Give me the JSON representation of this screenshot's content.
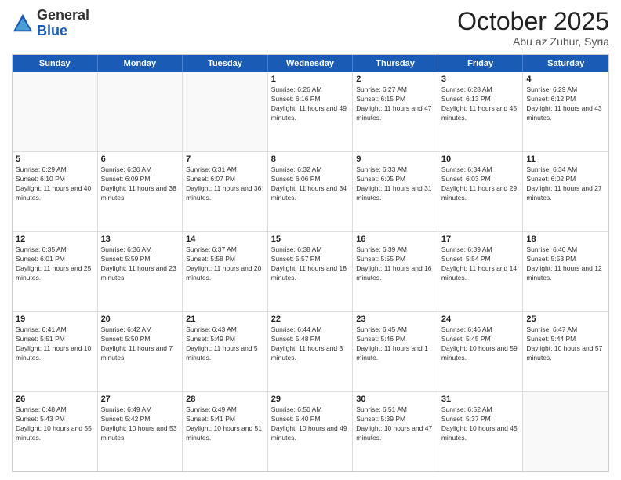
{
  "logo": {
    "general": "General",
    "blue": "Blue"
  },
  "title": {
    "month_year": "October 2025",
    "location": "Abu az Zuhur, Syria"
  },
  "header_days": [
    "Sunday",
    "Monday",
    "Tuesday",
    "Wednesday",
    "Thursday",
    "Friday",
    "Saturday"
  ],
  "weeks": [
    [
      {
        "day": "",
        "sunrise": "",
        "sunset": "",
        "daylight": ""
      },
      {
        "day": "",
        "sunrise": "",
        "sunset": "",
        "daylight": ""
      },
      {
        "day": "",
        "sunrise": "",
        "sunset": "",
        "daylight": ""
      },
      {
        "day": "1",
        "sunrise": "Sunrise: 6:26 AM",
        "sunset": "Sunset: 6:16 PM",
        "daylight": "Daylight: 11 hours and 49 minutes."
      },
      {
        "day": "2",
        "sunrise": "Sunrise: 6:27 AM",
        "sunset": "Sunset: 6:15 PM",
        "daylight": "Daylight: 11 hours and 47 minutes."
      },
      {
        "day": "3",
        "sunrise": "Sunrise: 6:28 AM",
        "sunset": "Sunset: 6:13 PM",
        "daylight": "Daylight: 11 hours and 45 minutes."
      },
      {
        "day": "4",
        "sunrise": "Sunrise: 6:29 AM",
        "sunset": "Sunset: 6:12 PM",
        "daylight": "Daylight: 11 hours and 43 minutes."
      }
    ],
    [
      {
        "day": "5",
        "sunrise": "Sunrise: 6:29 AM",
        "sunset": "Sunset: 6:10 PM",
        "daylight": "Daylight: 11 hours and 40 minutes."
      },
      {
        "day": "6",
        "sunrise": "Sunrise: 6:30 AM",
        "sunset": "Sunset: 6:09 PM",
        "daylight": "Daylight: 11 hours and 38 minutes."
      },
      {
        "day": "7",
        "sunrise": "Sunrise: 6:31 AM",
        "sunset": "Sunset: 6:07 PM",
        "daylight": "Daylight: 11 hours and 36 minutes."
      },
      {
        "day": "8",
        "sunrise": "Sunrise: 6:32 AM",
        "sunset": "Sunset: 6:06 PM",
        "daylight": "Daylight: 11 hours and 34 minutes."
      },
      {
        "day": "9",
        "sunrise": "Sunrise: 6:33 AM",
        "sunset": "Sunset: 6:05 PM",
        "daylight": "Daylight: 11 hours and 31 minutes."
      },
      {
        "day": "10",
        "sunrise": "Sunrise: 6:34 AM",
        "sunset": "Sunset: 6:03 PM",
        "daylight": "Daylight: 11 hours and 29 minutes."
      },
      {
        "day": "11",
        "sunrise": "Sunrise: 6:34 AM",
        "sunset": "Sunset: 6:02 PM",
        "daylight": "Daylight: 11 hours and 27 minutes."
      }
    ],
    [
      {
        "day": "12",
        "sunrise": "Sunrise: 6:35 AM",
        "sunset": "Sunset: 6:01 PM",
        "daylight": "Daylight: 11 hours and 25 minutes."
      },
      {
        "day": "13",
        "sunrise": "Sunrise: 6:36 AM",
        "sunset": "Sunset: 5:59 PM",
        "daylight": "Daylight: 11 hours and 23 minutes."
      },
      {
        "day": "14",
        "sunrise": "Sunrise: 6:37 AM",
        "sunset": "Sunset: 5:58 PM",
        "daylight": "Daylight: 11 hours and 20 minutes."
      },
      {
        "day": "15",
        "sunrise": "Sunrise: 6:38 AM",
        "sunset": "Sunset: 5:57 PM",
        "daylight": "Daylight: 11 hours and 18 minutes."
      },
      {
        "day": "16",
        "sunrise": "Sunrise: 6:39 AM",
        "sunset": "Sunset: 5:55 PM",
        "daylight": "Daylight: 11 hours and 16 minutes."
      },
      {
        "day": "17",
        "sunrise": "Sunrise: 6:39 AM",
        "sunset": "Sunset: 5:54 PM",
        "daylight": "Daylight: 11 hours and 14 minutes."
      },
      {
        "day": "18",
        "sunrise": "Sunrise: 6:40 AM",
        "sunset": "Sunset: 5:53 PM",
        "daylight": "Daylight: 11 hours and 12 minutes."
      }
    ],
    [
      {
        "day": "19",
        "sunrise": "Sunrise: 6:41 AM",
        "sunset": "Sunset: 5:51 PM",
        "daylight": "Daylight: 11 hours and 10 minutes."
      },
      {
        "day": "20",
        "sunrise": "Sunrise: 6:42 AM",
        "sunset": "Sunset: 5:50 PM",
        "daylight": "Daylight: 11 hours and 7 minutes."
      },
      {
        "day": "21",
        "sunrise": "Sunrise: 6:43 AM",
        "sunset": "Sunset: 5:49 PM",
        "daylight": "Daylight: 11 hours and 5 minutes."
      },
      {
        "day": "22",
        "sunrise": "Sunrise: 6:44 AM",
        "sunset": "Sunset: 5:48 PM",
        "daylight": "Daylight: 11 hours and 3 minutes."
      },
      {
        "day": "23",
        "sunrise": "Sunrise: 6:45 AM",
        "sunset": "Sunset: 5:46 PM",
        "daylight": "Daylight: 11 hours and 1 minute."
      },
      {
        "day": "24",
        "sunrise": "Sunrise: 6:46 AM",
        "sunset": "Sunset: 5:45 PM",
        "daylight": "Daylight: 10 hours and 59 minutes."
      },
      {
        "day": "25",
        "sunrise": "Sunrise: 6:47 AM",
        "sunset": "Sunset: 5:44 PM",
        "daylight": "Daylight: 10 hours and 57 minutes."
      }
    ],
    [
      {
        "day": "26",
        "sunrise": "Sunrise: 6:48 AM",
        "sunset": "Sunset: 5:43 PM",
        "daylight": "Daylight: 10 hours and 55 minutes."
      },
      {
        "day": "27",
        "sunrise": "Sunrise: 6:49 AM",
        "sunset": "Sunset: 5:42 PM",
        "daylight": "Daylight: 10 hours and 53 minutes."
      },
      {
        "day": "28",
        "sunrise": "Sunrise: 6:49 AM",
        "sunset": "Sunset: 5:41 PM",
        "daylight": "Daylight: 10 hours and 51 minutes."
      },
      {
        "day": "29",
        "sunrise": "Sunrise: 6:50 AM",
        "sunset": "Sunset: 5:40 PM",
        "daylight": "Daylight: 10 hours and 49 minutes."
      },
      {
        "day": "30",
        "sunrise": "Sunrise: 6:51 AM",
        "sunset": "Sunset: 5:39 PM",
        "daylight": "Daylight: 10 hours and 47 minutes."
      },
      {
        "day": "31",
        "sunrise": "Sunrise: 6:52 AM",
        "sunset": "Sunset: 5:37 PM",
        "daylight": "Daylight: 10 hours and 45 minutes."
      },
      {
        "day": "",
        "sunrise": "",
        "sunset": "",
        "daylight": ""
      }
    ]
  ]
}
